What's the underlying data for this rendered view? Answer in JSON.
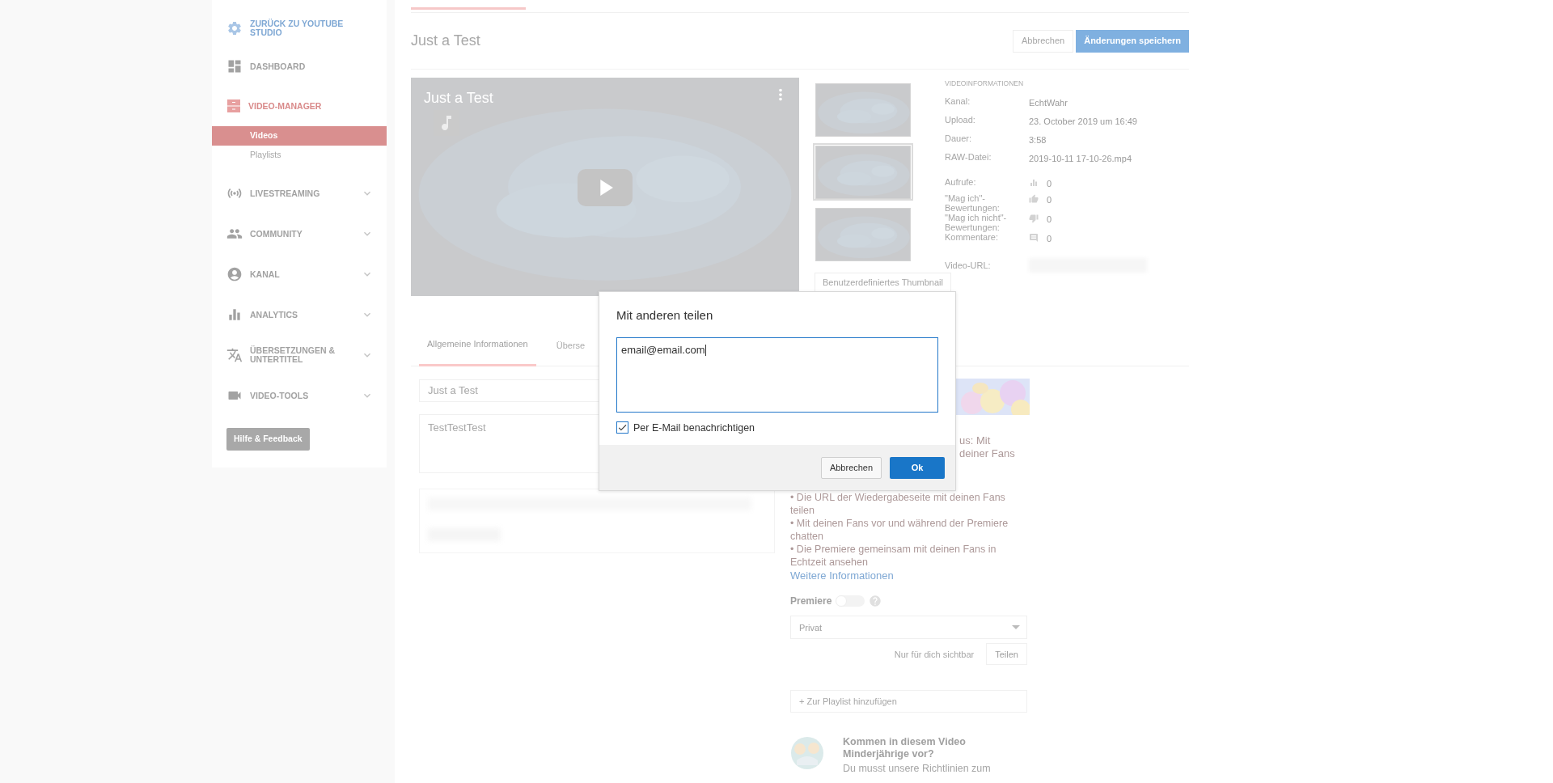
{
  "sidebar": {
    "back": "ZURÜCK ZU YOUTUBE STUDIO",
    "items": [
      {
        "label": "DASHBOARD",
        "selected": false,
        "expandable": false
      },
      {
        "label": "VIDEO-MANAGER",
        "selected": true,
        "expandable": false,
        "children": [
          {
            "label": "Videos",
            "selected": true
          },
          {
            "label": "Playlists",
            "selected": false
          }
        ]
      },
      {
        "label": "LIVESTREAMING",
        "selected": false,
        "expandable": true
      },
      {
        "label": "COMMUNITY",
        "selected": false,
        "expandable": true
      },
      {
        "label": "KANAL",
        "selected": false,
        "expandable": true
      },
      {
        "label": "ANALYTICS",
        "selected": false,
        "expandable": true
      },
      {
        "label": "ÜBERSETZUNGEN & UNTERTITEL",
        "selected": false,
        "expandable": true
      },
      {
        "label": "VIDEO-TOOLS",
        "selected": false,
        "expandable": true
      }
    ],
    "help_button": "Hilfe & Feedback"
  },
  "header": {
    "title": "Just a Test",
    "cancel": "Abbrechen",
    "save": "Änderungen speichern"
  },
  "player": {
    "title": "Just a Test"
  },
  "thumbnails": [
    {
      "selected": false
    },
    {
      "selected": true
    },
    {
      "selected": false
    }
  ],
  "custom_thumbnail_button": "Benutzerdefiniertes Thumbnail",
  "video_info": {
    "heading": "VIDEOINFORMATIONEN",
    "rows": [
      {
        "kind": "text",
        "label": "Kanal:",
        "value": "EchtWahr"
      },
      {
        "kind": "text",
        "label": "Upload:",
        "value": "23. October 2019 um 16:49"
      },
      {
        "kind": "text",
        "label": "Dauer:",
        "value": "3:58"
      },
      {
        "kind": "text",
        "label": "RAW-Datei:",
        "value": "2019-10-11 17-10-26.mp4"
      },
      {
        "kind": "stat",
        "label": "Aufrufe:",
        "value": "0"
      },
      {
        "kind": "stat",
        "label": "\"Mag ich\"-Bewertungen:",
        "value": "0"
      },
      {
        "kind": "stat",
        "label": "\"Mag ich nicht\"-Bewertungen:",
        "value": "0"
      },
      {
        "kind": "stat",
        "label": "Kommentare:",
        "value": "0"
      },
      {
        "kind": "hidden",
        "label": "Video-URL:"
      }
    ]
  },
  "tabs": [
    {
      "label": "Allgemeine Informationen",
      "selected": true
    },
    {
      "label": "Überse",
      "selected": false
    }
  ],
  "form": {
    "title_value": "Just a Test",
    "description_value": "TestTestTest"
  },
  "premiere_info": {
    "fragments": [
      "us: Mit",
      "deiner Fans"
    ],
    "bullets": [
      "• Die URL der Wiedergabeseite mit deinen Fans teilen",
      "• Mit deinen Fans vor und während der Premiere chatten",
      "• Die Premiere gemeinsam mit deinen Fans in Echtzeit ansehen"
    ],
    "more_link": "Weitere Informationen"
  },
  "premiere": {
    "label": "Premiere",
    "on": false
  },
  "privacy": {
    "value": "Privat",
    "note": "Nur für dich sichtbar",
    "share_button": "Teilen"
  },
  "playlist_button": "+ Zur Playlist hinzufügen",
  "minors": {
    "title": "Kommen in diesem Video Minderjährige vor?",
    "text": "Du musst unsere Richtlinien zum"
  },
  "dialog": {
    "title": "Mit anderen teilen",
    "value": "email@email.com",
    "notify": {
      "label": "Per E-Mail benachrichtigen",
      "checked": true
    },
    "cancel": "Abbrechen",
    "ok": "Ok"
  }
}
